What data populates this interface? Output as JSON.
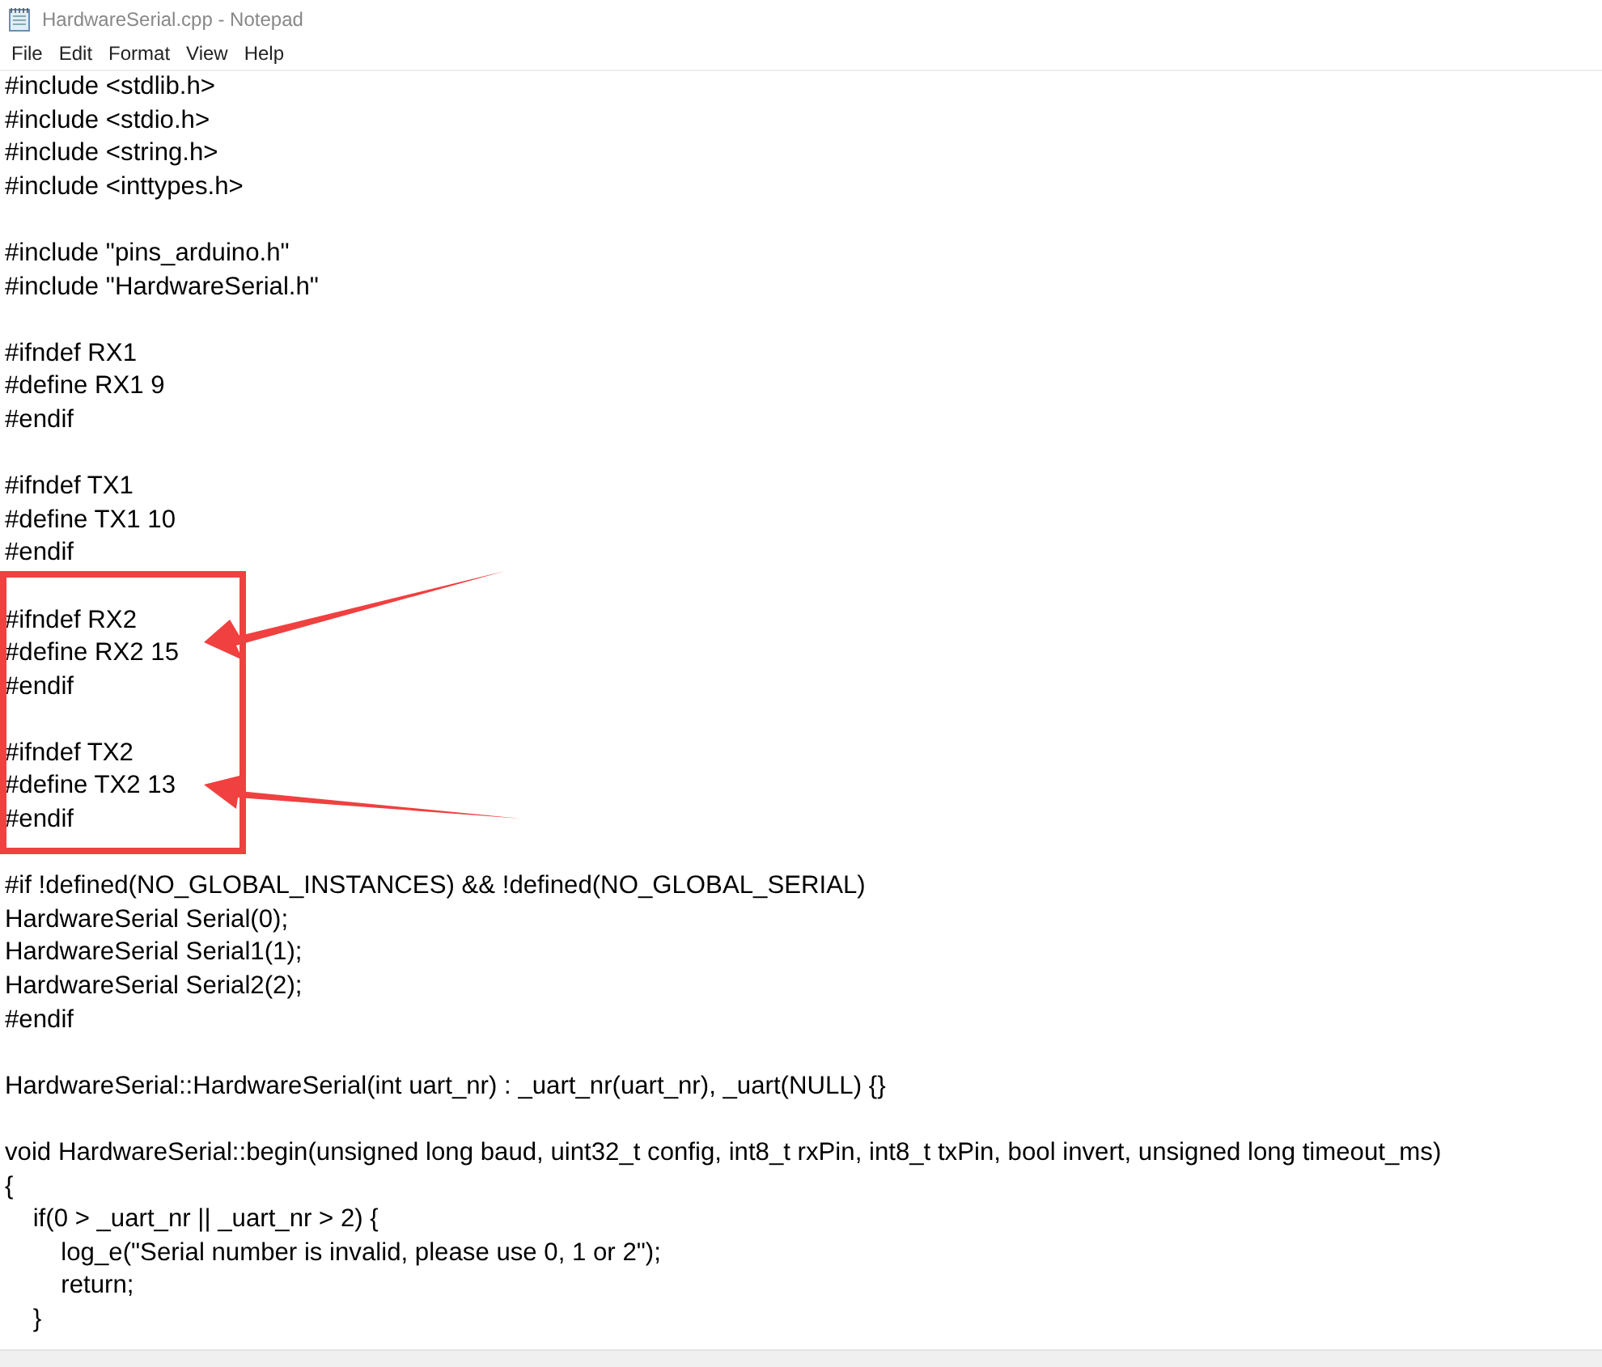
{
  "window": {
    "title": "HardwareSerial.cpp - Notepad"
  },
  "menu": [
    "File",
    "Edit",
    "Format",
    "View",
    "Help"
  ],
  "editor": {
    "blocks": [
      [
        "#include <stdlib.h>",
        "#include <stdio.h>",
        "#include <string.h>",
        "#include <inttypes.h>"
      ],
      [
        "#include \"pins_arduino.h\"",
        "#include \"HardwareSerial.h\""
      ],
      [
        "#ifndef RX1",
        "#define RX1 9",
        "#endif"
      ],
      [
        "#ifndef TX1",
        "#define TX1 10",
        "#endif"
      ],
      [
        "#ifndef RX2",
        "#define RX2 15",
        "#endif"
      ],
      [
        "#ifndef TX2",
        "#define TX2 13",
        "#endif"
      ],
      [
        "#if !defined(NO_GLOBAL_INSTANCES) && !defined(NO_GLOBAL_SERIAL)",
        "HardwareSerial Serial(0);",
        "HardwareSerial Serial1(1);",
        "HardwareSerial Serial2(2);",
        "#endif"
      ],
      [
        "HardwareSerial::HardwareSerial(int uart_nr) : _uart_nr(uart_nr), _uart(NULL) {}"
      ],
      [
        "void HardwareSerial::begin(unsigned long baud, uint32_t config, int8_t rxPin, int8_t txPin, bool invert, unsigned long timeout_ms)",
        "{",
        "    if(0 > _uart_nr || _uart_nr > 2) {",
        "        log_e(\"Serial number is invalid, please use 0, 1 or 2\");",
        "        return;",
        "    }"
      ]
    ]
  }
}
